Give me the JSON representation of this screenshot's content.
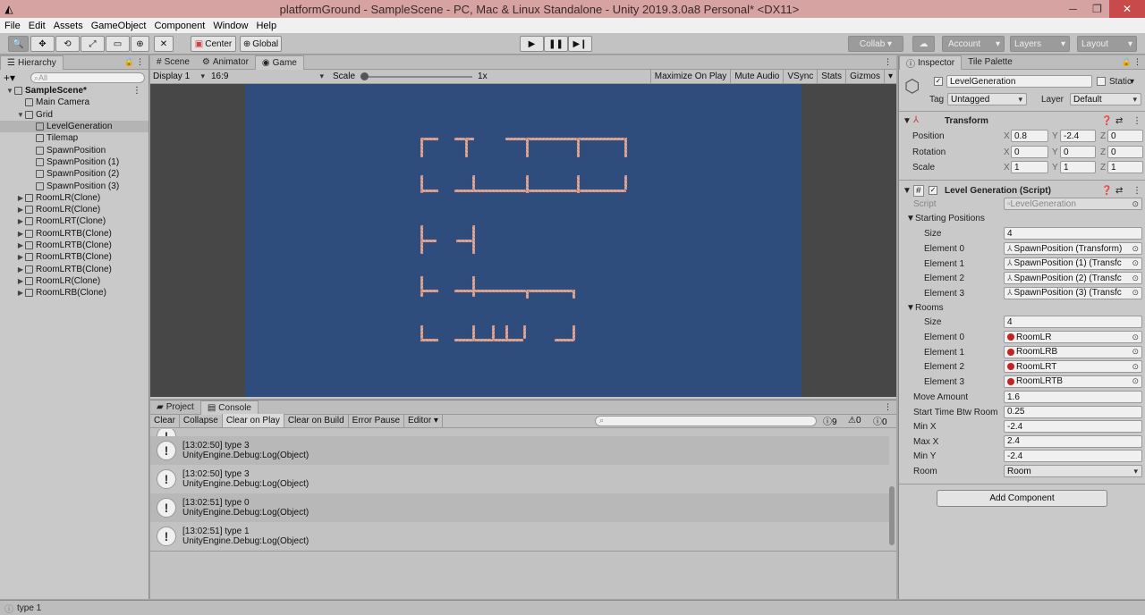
{
  "window": {
    "title": "platformGround - SampleScene - PC, Mac & Linux Standalone - Unity 2019.3.0a8 Personal* <DX11>",
    "minimize": "─",
    "maximize": "❐",
    "close": "✕"
  },
  "menu": [
    "File",
    "Edit",
    "Assets",
    "GameObject",
    "Component",
    "Window",
    "Help"
  ],
  "toolbar": {
    "center": "Center",
    "global": "Global",
    "collab": "Collab",
    "account": "Account",
    "layers": "Layers",
    "layout": "Layout"
  },
  "hierarchy": {
    "tab": "Hierarchy",
    "search_placeholder": "All",
    "items": [
      {
        "label": "SampleScene*",
        "depth": 0,
        "arrow": "▼",
        "bold": true
      },
      {
        "label": "Main Camera",
        "depth": 1,
        "arrow": ""
      },
      {
        "label": "Grid",
        "depth": 1,
        "arrow": "▼"
      },
      {
        "label": "LevelGeneration",
        "depth": 2,
        "arrow": "",
        "selected": true
      },
      {
        "label": "Tilemap",
        "depth": 2,
        "arrow": ""
      },
      {
        "label": "SpawnPosition",
        "depth": 2,
        "arrow": ""
      },
      {
        "label": "SpawnPosition (1)",
        "depth": 2,
        "arrow": ""
      },
      {
        "label": "SpawnPosition (2)",
        "depth": 2,
        "arrow": ""
      },
      {
        "label": "SpawnPosition (3)",
        "depth": 2,
        "arrow": ""
      },
      {
        "label": "RoomLR(Clone)",
        "depth": 1,
        "arrow": "▶"
      },
      {
        "label": "RoomLR(Clone)",
        "depth": 1,
        "arrow": "▶"
      },
      {
        "label": "RoomLRT(Clone)",
        "depth": 1,
        "arrow": "▶"
      },
      {
        "label": "RoomLRTB(Clone)",
        "depth": 1,
        "arrow": "▶"
      },
      {
        "label": "RoomLRTB(Clone)",
        "depth": 1,
        "arrow": "▶"
      },
      {
        "label": "RoomLRTB(Clone)",
        "depth": 1,
        "arrow": "▶"
      },
      {
        "label": "RoomLRTB(Clone)",
        "depth": 1,
        "arrow": "▶"
      },
      {
        "label": "RoomLR(Clone)",
        "depth": 1,
        "arrow": "▶"
      },
      {
        "label": "RoomLRB(Clone)",
        "depth": 1,
        "arrow": "▶"
      }
    ]
  },
  "center_tabs": {
    "scene": "Scene",
    "animator": "Animator",
    "game": "Game"
  },
  "game_bar": {
    "display": "Display 1",
    "aspect": "16:9",
    "scale_label": "Scale",
    "scale_value": "1x",
    "maximize": "Maximize On Play",
    "mute": "Mute Audio",
    "vsync": "VSync",
    "stats": "Stats",
    "gizmos": "Gizmos"
  },
  "bottom_tabs": {
    "project": "Project",
    "console": "Console"
  },
  "console": {
    "buttons": [
      "Clear",
      "Collapse",
      "Clear on Play",
      "Clear on Build",
      "Error Pause",
      "Editor"
    ],
    "counts": {
      "logs": "9",
      "warnings": "0",
      "errors": "0"
    },
    "entries": [
      {
        "line1": "[13:02:50] type 3",
        "line2": "UnityEngine.Debug:Log(Object)"
      },
      {
        "line1": "[13:02:50] type 3",
        "line2": "UnityEngine.Debug:Log(Object)"
      },
      {
        "line1": "[13:02:51] type 0",
        "line2": "UnityEngine.Debug:Log(Object)"
      },
      {
        "line1": "[13:02:51] type 1",
        "line2": "UnityEngine.Debug:Log(Object)"
      }
    ]
  },
  "inspector": {
    "tabs": {
      "inspector": "Inspector",
      "tile_palette": "Tile Palette"
    },
    "object_name": "LevelGeneration",
    "static": "Static",
    "tag_label": "Tag",
    "tag": "Untagged",
    "layer_label": "Layer",
    "layer": "Default",
    "transform": {
      "title": "Transform",
      "position": {
        "label": "Position",
        "x": "0.8",
        "y": "-2.4",
        "z": "0"
      },
      "rotation": {
        "label": "Rotation",
        "x": "0",
        "y": "0",
        "z": "0"
      },
      "scale": {
        "label": "Scale",
        "x": "1",
        "y": "1",
        "z": "1"
      }
    },
    "script": {
      "title": "Level Generation (Script)",
      "script_label": "Script",
      "script_value": "LevelGeneration",
      "starting_positions": {
        "label": "Starting Positions",
        "size_label": "Size",
        "size": "4",
        "elements": [
          {
            "label": "Element 0",
            "value": "SpawnPosition (Transform)"
          },
          {
            "label": "Element 1",
            "value": "SpawnPosition (1) (Transfc"
          },
          {
            "label": "Element 2",
            "value": "SpawnPosition (2) (Transfc"
          },
          {
            "label": "Element 3",
            "value": "SpawnPosition (3) (Transfc"
          }
        ]
      },
      "rooms": {
        "label": "Rooms",
        "size_label": "Size",
        "size": "4",
        "elements": [
          {
            "label": "Element 0",
            "value": "RoomLR"
          },
          {
            "label": "Element 1",
            "value": "RoomLRB"
          },
          {
            "label": "Element 2",
            "value": "RoomLRT"
          },
          {
            "label": "Element 3",
            "value": "RoomLRTB"
          }
        ]
      },
      "fields": [
        {
          "label": "Move Amount",
          "value": "1.6"
        },
        {
          "label": "Start Time Btw Room",
          "value": "0.25"
        },
        {
          "label": "Min X",
          "value": "-2.4"
        },
        {
          "label": "Max X",
          "value": "2.4"
        },
        {
          "label": "Min Y",
          "value": "-2.4"
        }
      ],
      "room_label": "Room",
      "room_value": "Room"
    },
    "add_component": "Add Component"
  },
  "status": "type 1",
  "colors": {
    "game_bg": "#2f4d7c",
    "tile": "#d9a89c",
    "title_bar": "#d7a2a2"
  }
}
